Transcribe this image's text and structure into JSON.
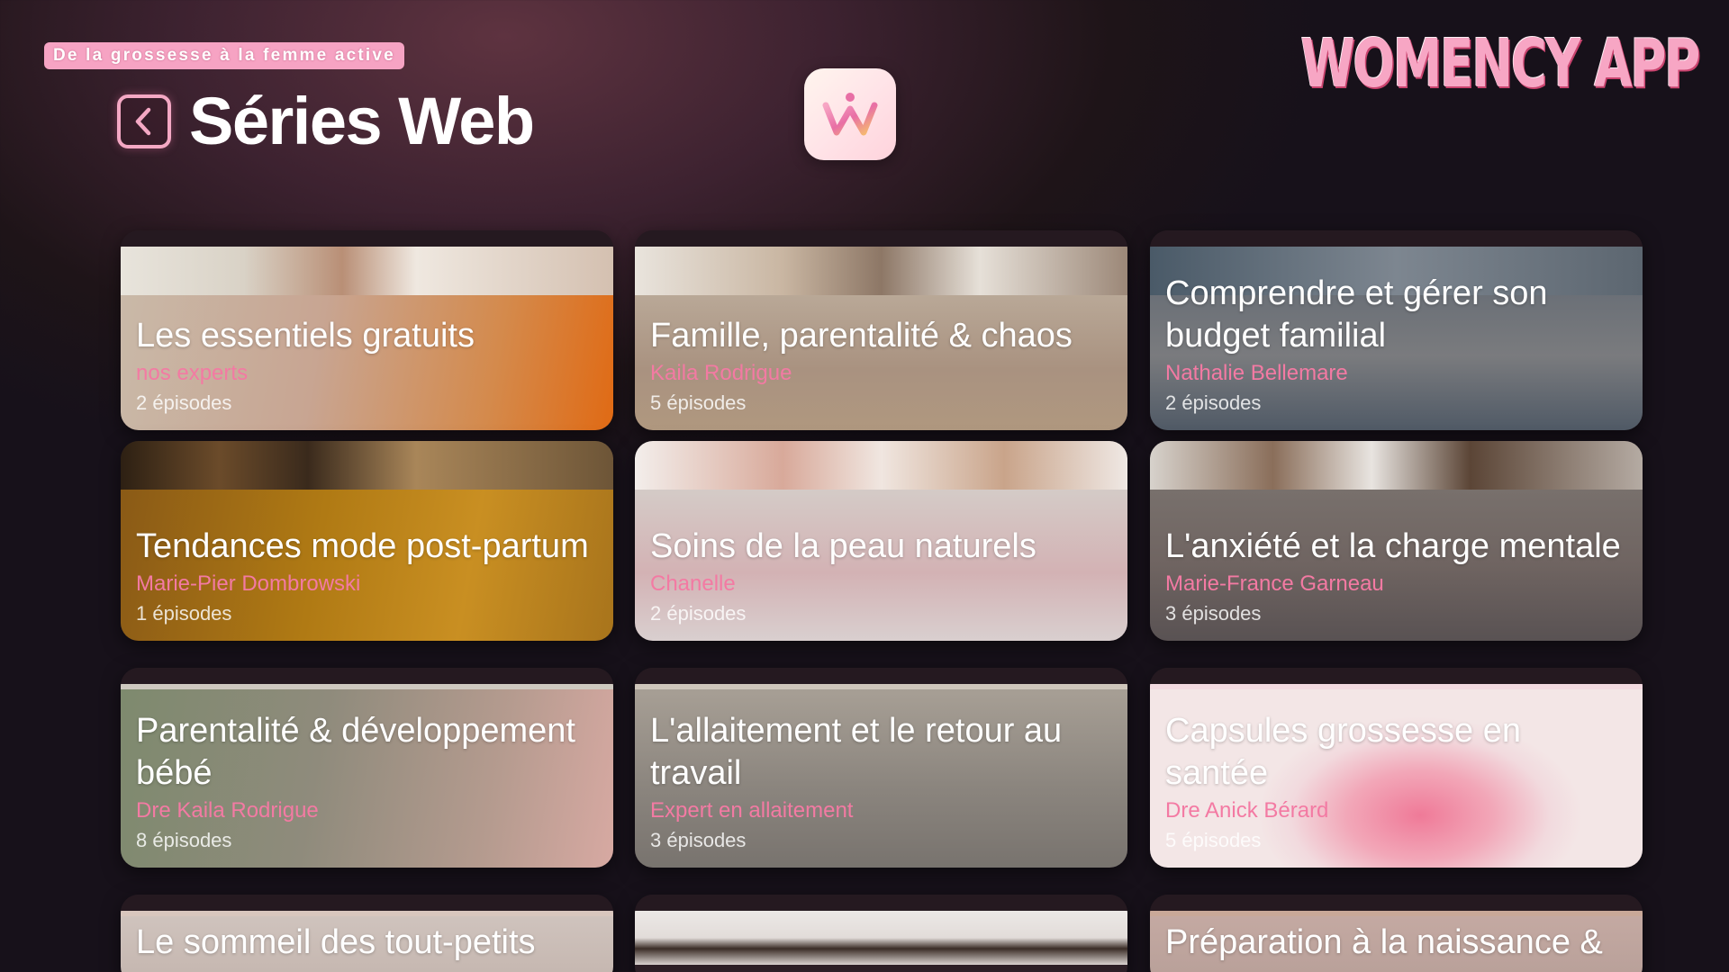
{
  "tagline": "De la grossesse à la femme active",
  "brand": "WOMENCY APP",
  "header": {
    "title": "Séries Web",
    "back_icon": "chevron-left-icon"
  },
  "app_icon": {
    "letter": "W"
  },
  "series": [
    {
      "title": "Les essentiels gratuits",
      "author": "nos experts",
      "episodes": "2 épisodes"
    },
    {
      "title": "Famille, parentalité & chaos",
      "author": "Kaila Rodrigue",
      "episodes": "5 épisodes"
    },
    {
      "title": "Comprendre et gérer son budget familial",
      "author": "Nathalie Bellemare",
      "episodes": "2 épisodes"
    },
    {
      "title": "Tendances mode post-partum",
      "author": "Marie-Pier Dombrowski",
      "episodes": "1 épisodes"
    },
    {
      "title": "Soins de la peau naturels",
      "author": "Chanelle",
      "episodes": "2 épisodes"
    },
    {
      "title": "L'anxiété et la charge mentale",
      "author": "Marie-France Garneau",
      "episodes": "3 épisodes"
    },
    {
      "title": "Parentalité & développement bébé",
      "author": "Dre Kaila Rodrigue",
      "episodes": "8 épisodes"
    },
    {
      "title": "L'allaitement et le retour au travail",
      "author": "Expert en allaitement",
      "episodes": "3 épisodes"
    },
    {
      "title": "Capsules grossesse en santée",
      "author": "Dre Anick Bérard",
      "episodes": "5 épisodes"
    },
    {
      "title": "Le sommeil des tout-petits",
      "author": "",
      "episodes": ""
    },
    {
      "title": "",
      "author": "",
      "episodes": ""
    },
    {
      "title": "Préparation à la naissance &",
      "author": "",
      "episodes": ""
    }
  ]
}
